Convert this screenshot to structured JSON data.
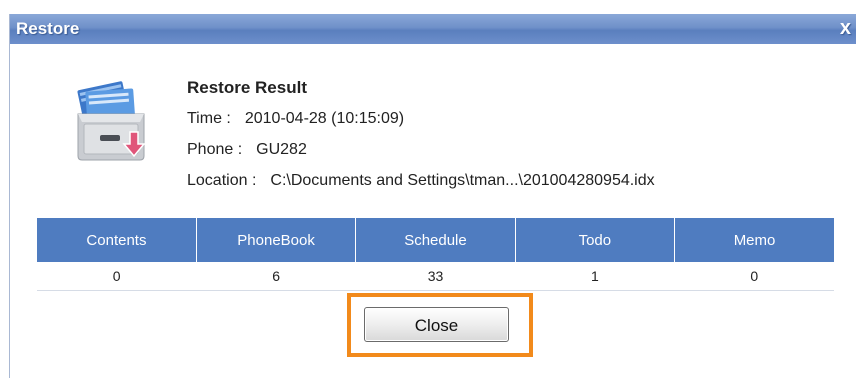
{
  "window": {
    "title": "Restore",
    "close_glyph": "x"
  },
  "icon": {
    "name": "restore-drawer-icon",
    "colors": {
      "paper_blue": "#4f8fd8",
      "arrow_pink": "#e0557a",
      "drawer_gray": "#c9ccd1"
    }
  },
  "result": {
    "heading": "Restore Result",
    "time_label": "Time :",
    "time_value": "2010-04-28 (10:15:09)",
    "phone_label": "Phone :",
    "phone_value": "GU282",
    "location_label": "Location :",
    "location_value": "C:\\Documents and Settings\\tman...\\201004280954.idx"
  },
  "table": {
    "headers": [
      "Contents",
      "PhoneBook",
      "Schedule",
      "Todo",
      "Memo"
    ],
    "values": [
      "0",
      "6",
      "33",
      "1",
      "0"
    ]
  },
  "buttons": {
    "close_label": "Close"
  },
  "colors": {
    "titlebar": "#6f90c9",
    "table_header": "#4f7cc0",
    "highlight": "#f28a1b"
  }
}
